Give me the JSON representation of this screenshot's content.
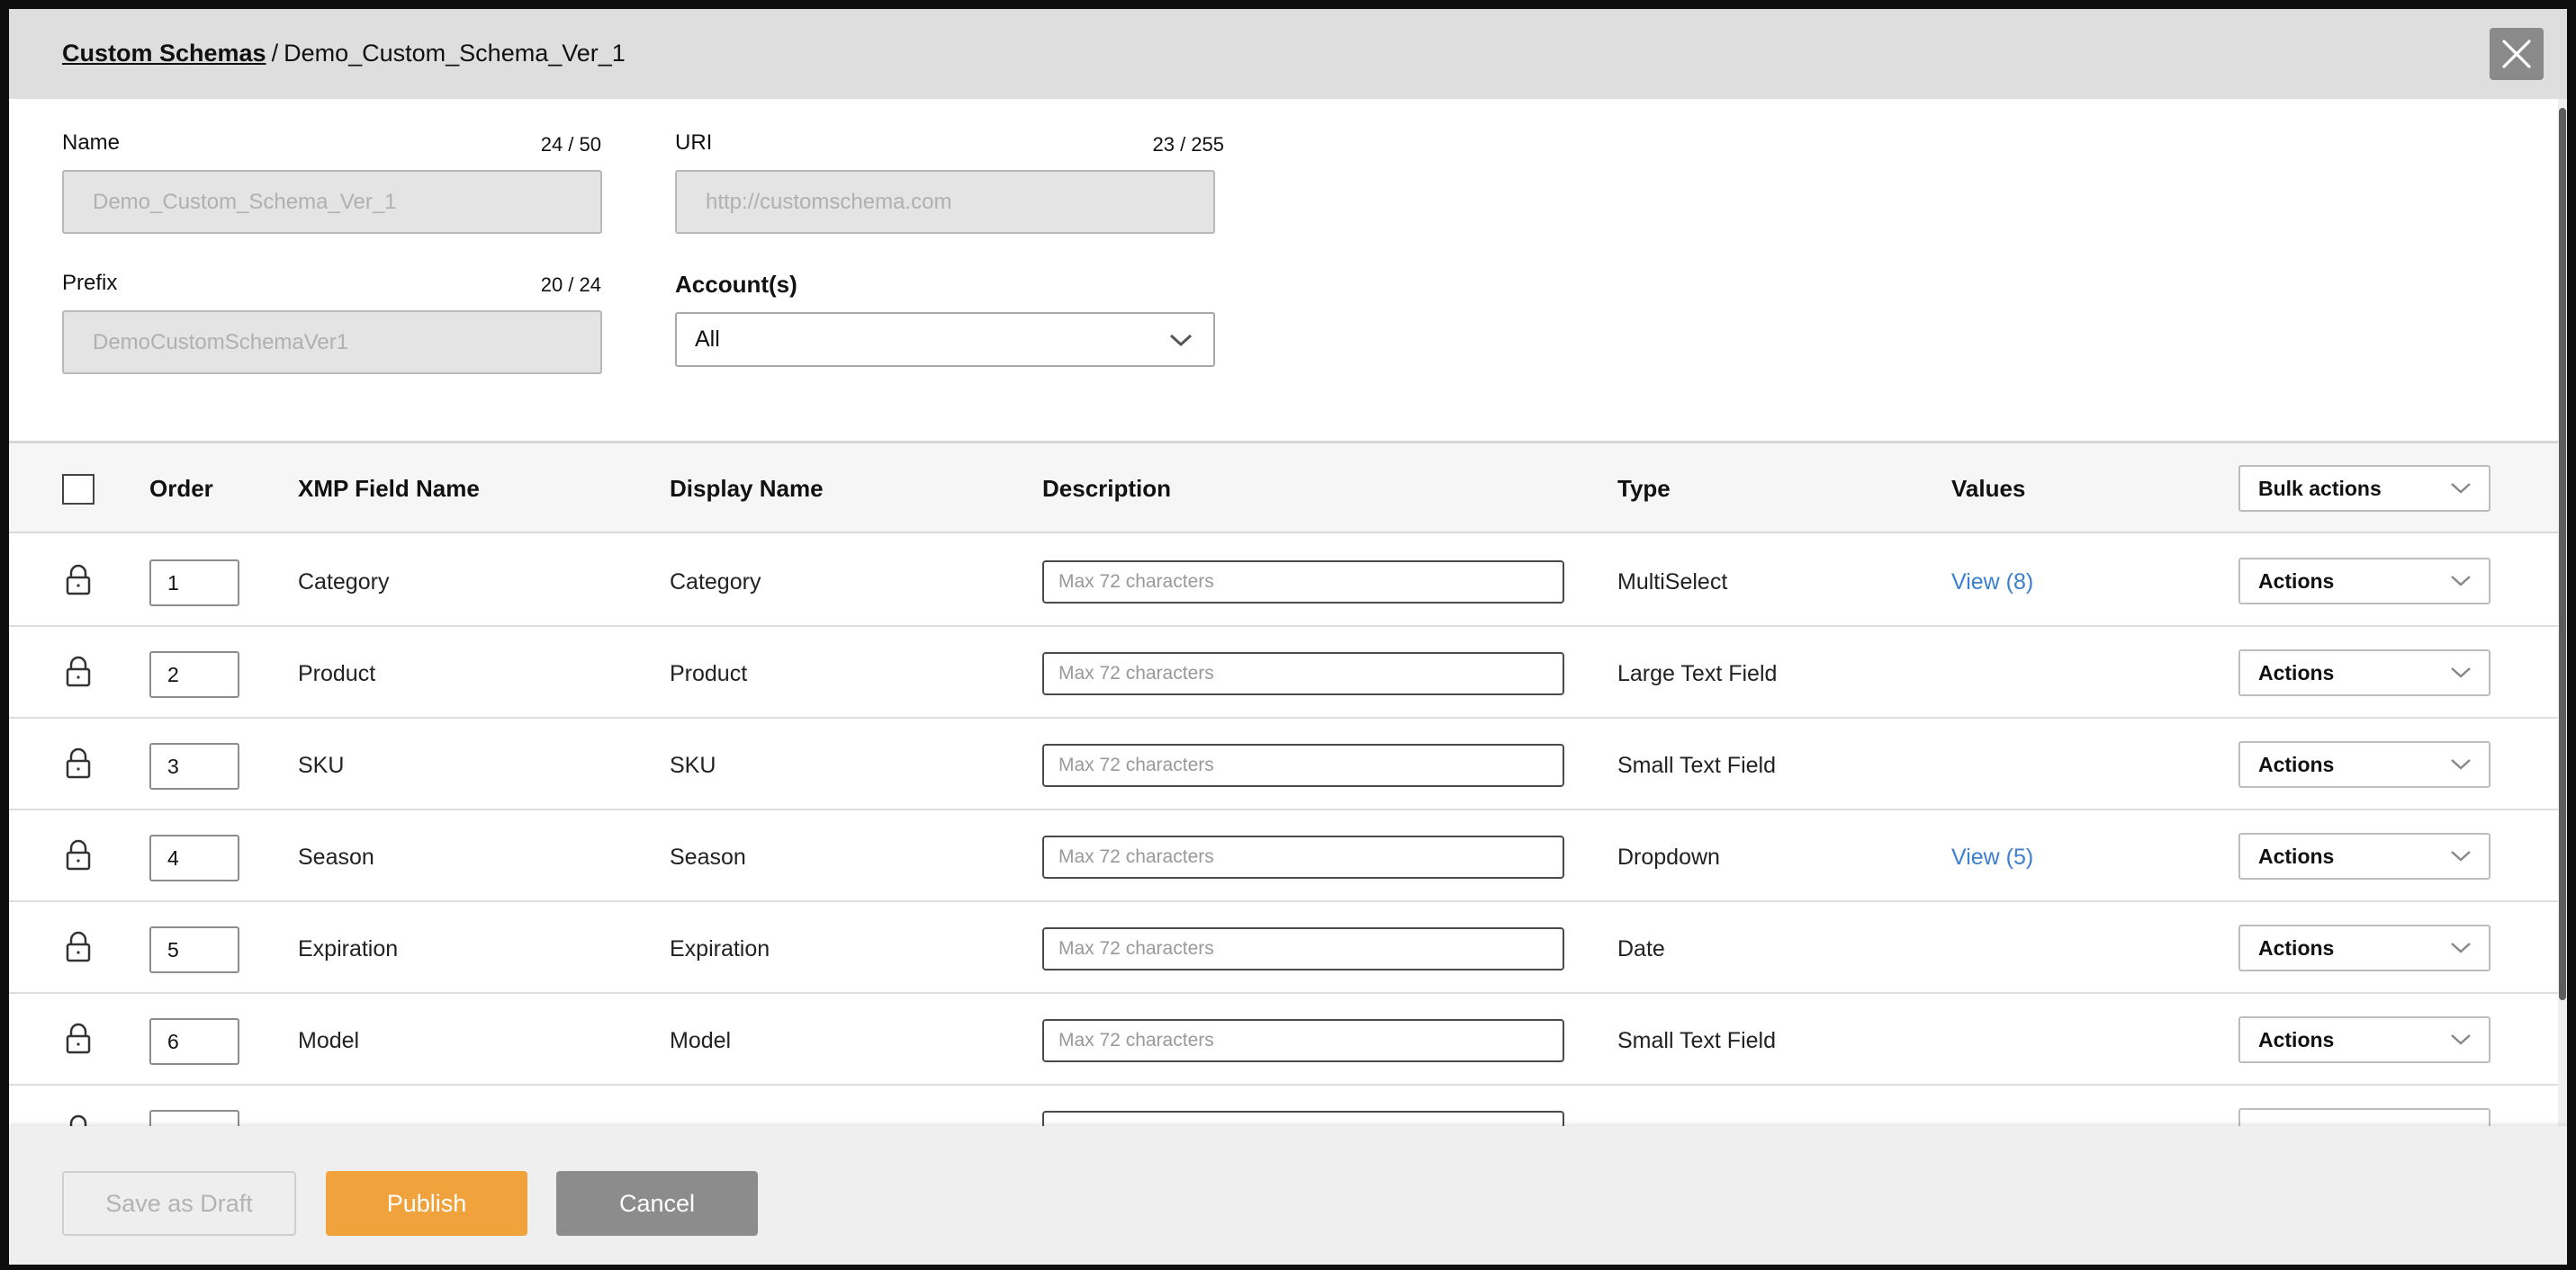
{
  "header": {
    "breadcrumb_link": "Custom Schemas",
    "breadcrumb_separator": "/",
    "breadcrumb_current": "Demo_Custom_Schema_Ver_1"
  },
  "form": {
    "name": {
      "label": "Name",
      "counter": "24 / 50",
      "placeholder": "Demo_Custom_Schema_Ver_1"
    },
    "uri": {
      "label": "URI",
      "counter": "23 / 255",
      "placeholder": "http://customschema.com"
    },
    "prefix": {
      "label": "Prefix",
      "counter": "20 / 24",
      "placeholder": "DemoCustomSchemaVer1"
    },
    "accounts": {
      "label": "Account(s)",
      "selected": "All"
    }
  },
  "table": {
    "headers": {
      "order": "Order",
      "xmp_field_name": "XMP Field Name",
      "display_name": "Display Name",
      "description": "Description",
      "type": "Type",
      "values": "Values",
      "bulk_actions": "Bulk actions"
    },
    "rows": [
      {
        "order": "1",
        "xmp": "Category",
        "display": "Category",
        "desc_placeholder": "Max 72 characters",
        "type": "MultiSelect",
        "values": "View (8)",
        "actions": "Actions"
      },
      {
        "order": "2",
        "xmp": "Product",
        "display": "Product",
        "desc_placeholder": "Max 72 characters",
        "type": "Large Text Field",
        "values": "",
        "actions": "Actions"
      },
      {
        "order": "3",
        "xmp": "SKU",
        "display": "SKU",
        "desc_placeholder": "Max 72 characters",
        "type": "Small Text Field",
        "values": "",
        "actions": "Actions"
      },
      {
        "order": "4",
        "xmp": "Season",
        "display": "Season",
        "desc_placeholder": "Max 72 characters",
        "type": "Dropdown",
        "values": "View (5)",
        "actions": "Actions"
      },
      {
        "order": "5",
        "xmp": "Expiration",
        "display": "Expiration",
        "desc_placeholder": "Max 72 characters",
        "type": "Date",
        "values": "",
        "actions": "Actions"
      },
      {
        "order": "6",
        "xmp": "Model",
        "display": "Model",
        "desc_placeholder": "Max 72 characters",
        "type": "Small Text Field",
        "values": "",
        "actions": "Actions"
      }
    ]
  },
  "footer": {
    "save_draft": "Save as Draft",
    "publish": "Publish",
    "cancel": "Cancel"
  },
  "colors": {
    "publish": "#f0a33c",
    "cancel": "#8c8c8c",
    "link": "#3a7fd0",
    "header_bg": "#dedede"
  },
  "icons": [
    "close-icon",
    "chevron-down-icon",
    "lock-icon"
  ]
}
